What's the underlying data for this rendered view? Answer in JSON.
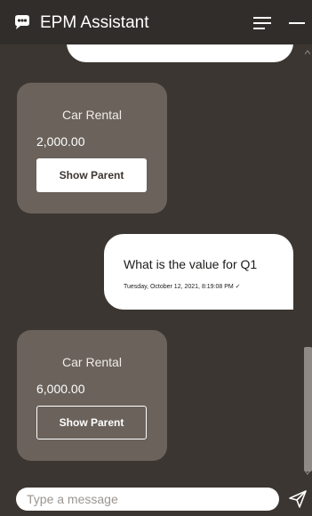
{
  "header": {
    "title": "EPM Assistant",
    "logo_icon": "chat-bubble-icon",
    "menu_icon": "hamburger-menu-icon",
    "minimize_icon": "minimize-icon"
  },
  "messages": {
    "card1": {
      "title": "Car Rental",
      "value": "2,000.00",
      "button_label": "Show Parent"
    },
    "user_message": {
      "text": "What is the value for Q1",
      "timestamp": "Tuesday, October 12, 2021, 8:19:08 PM ✓"
    },
    "card2": {
      "title": "Car Rental",
      "value": "6,000.00",
      "button_label": "Show Parent"
    }
  },
  "composer": {
    "placeholder": "Type a message",
    "send_icon": "send-icon"
  },
  "colors": {
    "header_bg": "#312d2a",
    "chat_bg": "#3b3631",
    "card_bg": "#6a625b",
    "bubble_bg": "#ffffff"
  }
}
